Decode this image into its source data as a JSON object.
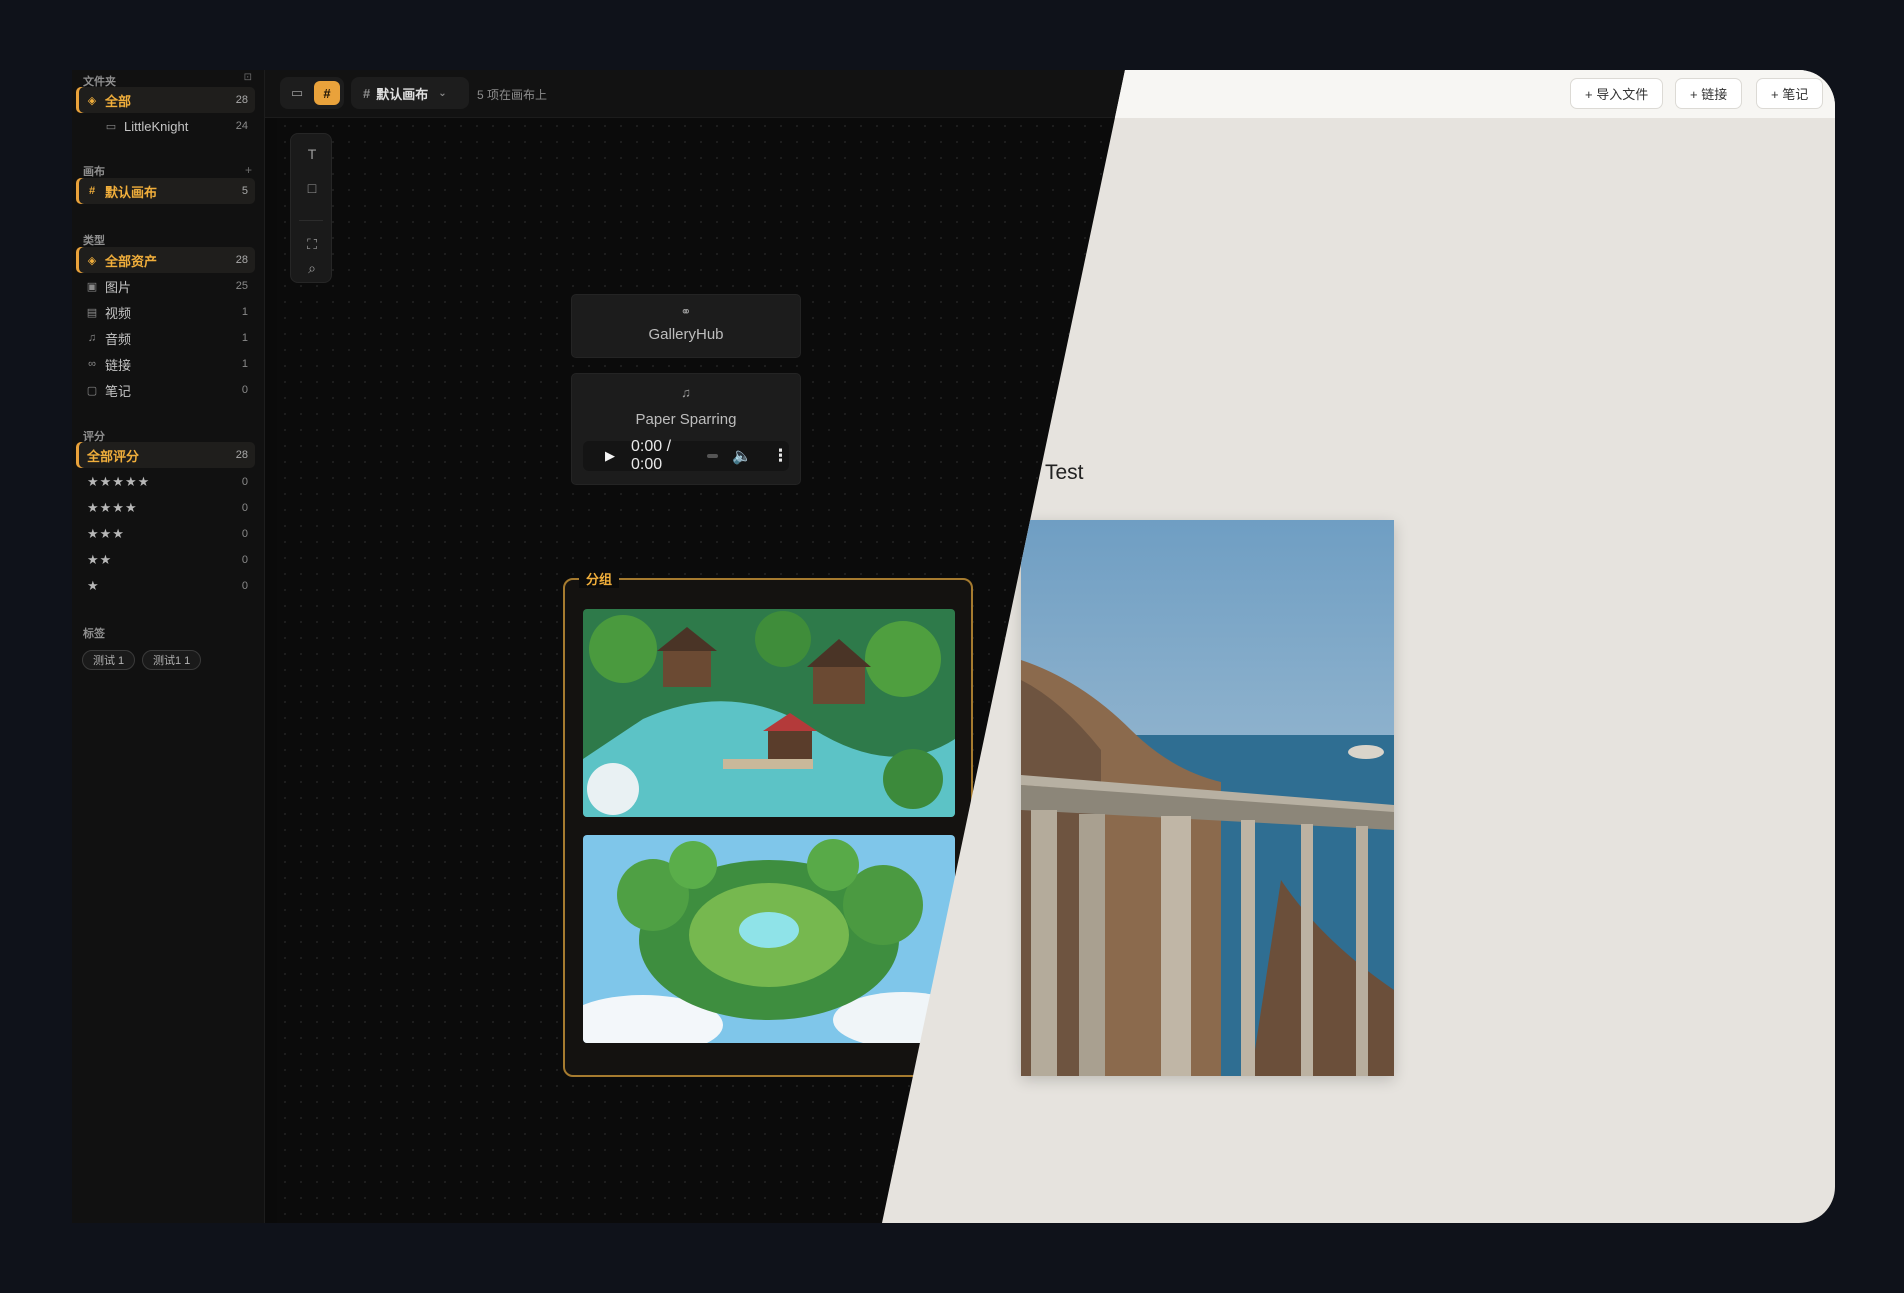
{
  "sidebar": {
    "folders": {
      "heading": "文件夹",
      "items": [
        {
          "label": "全部",
          "count": "28"
        },
        {
          "label": "LittleKnight",
          "count": "24"
        }
      ]
    },
    "canvases": {
      "heading": "画布",
      "add": "+",
      "items": [
        {
          "label": "默认画布",
          "count": "5"
        }
      ]
    },
    "types": {
      "heading": "类型",
      "items": [
        {
          "label": "全部资产",
          "count": "28"
        },
        {
          "label": "图片",
          "count": "25"
        },
        {
          "label": "视频",
          "count": "1"
        },
        {
          "label": "音频",
          "count": "1"
        },
        {
          "label": "链接",
          "count": "1"
        },
        {
          "label": "笔记",
          "count": "0"
        }
      ]
    },
    "ratings": {
      "heading": "评分",
      "items": [
        {
          "label": "全部评分",
          "count": "28"
        },
        {
          "label": "★★★★★",
          "count": "0"
        },
        {
          "label": "★★★★",
          "count": "0"
        },
        {
          "label": "★★★",
          "count": "0"
        },
        {
          "label": "★★",
          "count": "0"
        },
        {
          "label": "★",
          "count": "0"
        }
      ]
    },
    "tags": {
      "heading": "标签",
      "items": [
        "测试 1",
        "测试1 1"
      ]
    }
  },
  "topbar": {
    "canvas_name": "默认画布",
    "canvas_count": "5 项在画布上",
    "actions": [
      "+ 导入文件",
      "+ 链接",
      "+ 笔记"
    ]
  },
  "canvas": {
    "link_card": {
      "title": "GalleryHub",
      "icon": "link-icon"
    },
    "audio_card": {
      "title": "Paper Sparring",
      "time": "0:00 / 0:00",
      "icon": "music-note-icon"
    },
    "group": {
      "label": "分组"
    },
    "light_title": "Test"
  },
  "colors": {
    "accent": "#e9a23b",
    "dark_bg": "#0b0b0b",
    "light_bg": "#e6e3de"
  }
}
